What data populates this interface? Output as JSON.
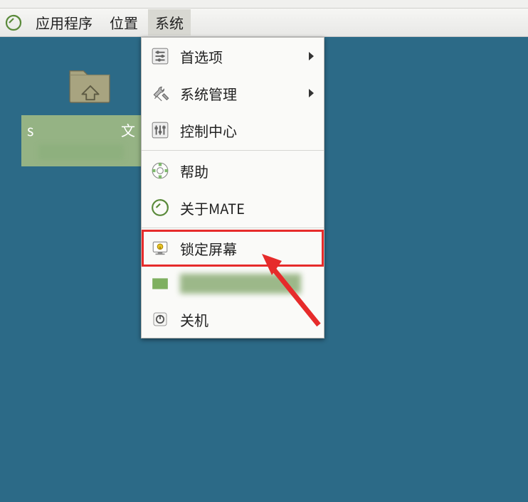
{
  "topbar": {
    "applications": "应用程序",
    "places": "位置",
    "system": "系统"
  },
  "desktop": {
    "selected_label_left": "s",
    "selected_label_right": "文"
  },
  "menu": {
    "preferences": "首选项",
    "administration": "系统管理",
    "control_center": "控制中心",
    "help": "帮助",
    "about_mate": "关于MATE",
    "lock_screen": "锁定屏幕",
    "shutdown": "关机"
  }
}
